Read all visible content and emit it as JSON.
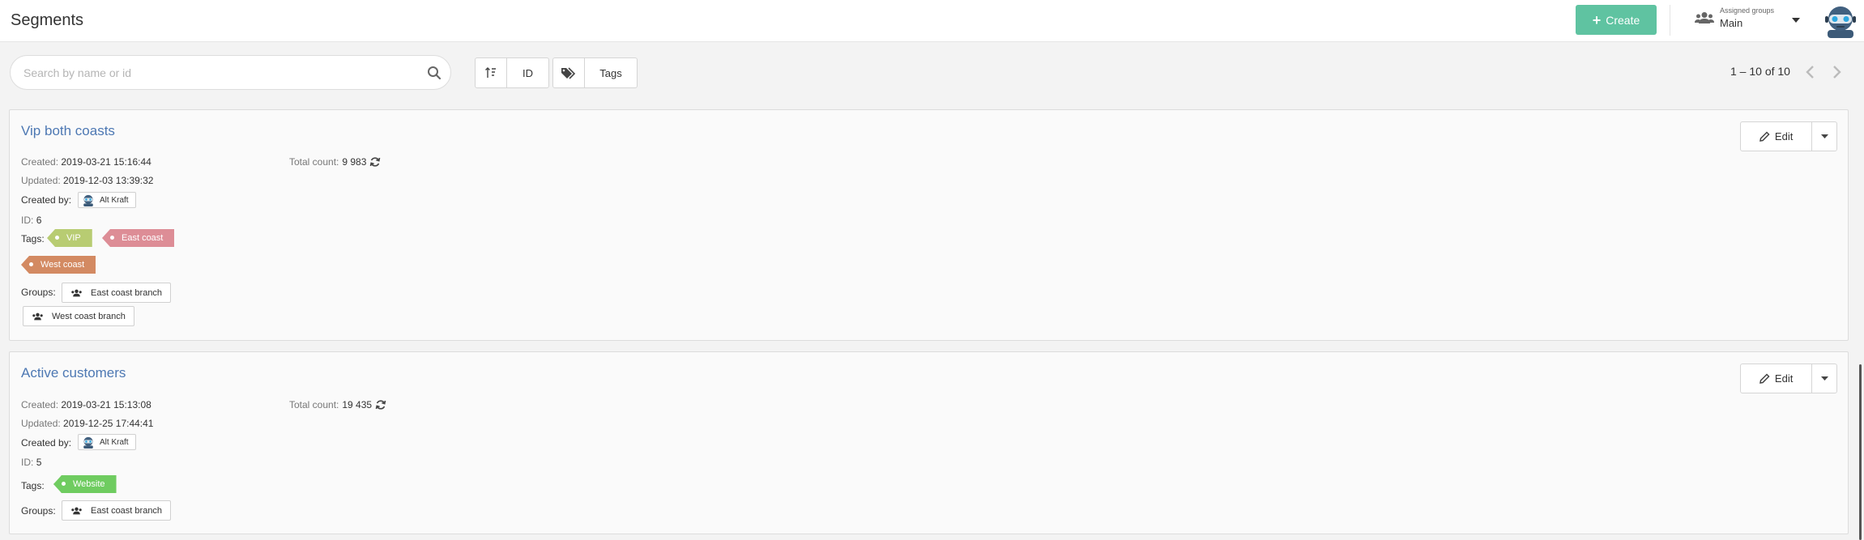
{
  "header": {
    "title": "Segments",
    "create_label": "Create",
    "assigned_groups_label": "Assigned groups",
    "assigned_groups_value": "Main"
  },
  "toolbar": {
    "search_placeholder": "Search by name or id",
    "sort_id_label": "ID",
    "tags_label": "Tags",
    "pagination": "1 – 10 of 10"
  },
  "colors": {
    "accent": "#5fc3a1",
    "link": "#4d78b3",
    "tag_vip": "#b8cc72",
    "tag_east": "#dd8d96",
    "tag_west": "#d38a62",
    "tag_website": "#6fcc60"
  },
  "segments": [
    {
      "title": "Vip both coasts",
      "created_label": "Created:",
      "created": "2019-03-21 15:16:44",
      "updated_label": "Updated:",
      "updated": "2019-12-03 13:39:32",
      "created_by_label": "Created by:",
      "created_by": "Alt Kraft",
      "id_label": "ID:",
      "id": "6",
      "tags_label": "Tags:",
      "tags": [
        "VIP",
        "East coast",
        "West coast"
      ],
      "groups_label": "Groups:",
      "groups": [
        "East coast branch",
        "West coast branch"
      ],
      "total_label": "Total count:",
      "total": "9 983",
      "edit_label": "Edit"
    },
    {
      "title": "Active customers",
      "created_label": "Created:",
      "created": "2019-03-21 15:13:08",
      "updated_label": "Updated:",
      "updated": "2019-12-25 17:44:41",
      "created_by_label": "Created by:",
      "created_by": "Alt Kraft",
      "id_label": "ID:",
      "id": "5",
      "tags_label": "Tags:",
      "tags": [
        "Website"
      ],
      "groups_label": "Groups:",
      "groups": [
        "East coast branch"
      ],
      "total_label": "Total count:",
      "total": "19 435",
      "edit_label": "Edit"
    }
  ]
}
